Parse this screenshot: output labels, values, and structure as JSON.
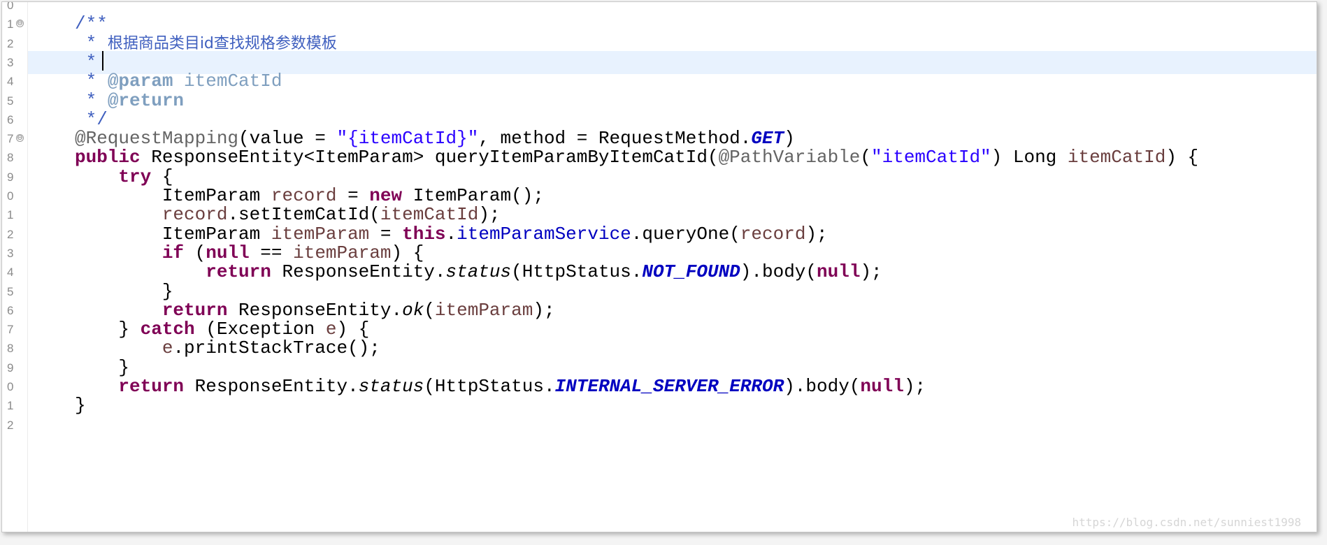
{
  "editor": {
    "line_numbers": [
      "0",
      "1",
      "2",
      "3",
      "4",
      "5",
      "6",
      "7",
      "8",
      "9",
      "0",
      "1",
      "2",
      "3",
      "4",
      "5",
      "6",
      "7",
      "8",
      "9",
      "0",
      "1",
      "2"
    ],
    "fold_markers": [
      "⊖",
      "⊖"
    ],
    "lines": [
      {
        "tokens": []
      },
      {
        "tokens": [
          {
            "c": "jd",
            "t": "/**"
          }
        ]
      },
      {
        "tokens": [
          {
            "c": "jd",
            "t": " * "
          },
          {
            "c": "jd cjk",
            "t": "根据商品类目id查找规格参数模板"
          }
        ]
      },
      {
        "tokens": [
          {
            "c": "jd",
            "t": " *"
          }
        ],
        "current": true
      },
      {
        "tokens": [
          {
            "c": "jd",
            "t": " * "
          },
          {
            "c": "jtag",
            "t": "@param"
          },
          {
            "c": "jtag-plain",
            "t": " itemCatId"
          }
        ]
      },
      {
        "tokens": [
          {
            "c": "jd",
            "t": " * "
          },
          {
            "c": "jtag",
            "t": "@return"
          }
        ]
      },
      {
        "tokens": [
          {
            "c": "jd",
            "t": " */"
          }
        ]
      },
      {
        "tokens": [
          {
            "c": "ann",
            "t": "@RequestMapping"
          },
          {
            "c": "",
            "t": "(value = "
          },
          {
            "c": "str",
            "t": "\"{itemCatId}\""
          },
          {
            "c": "",
            "t": ", method = RequestMethod."
          },
          {
            "c": "sfld",
            "t": "GET"
          },
          {
            "c": "",
            "t": ")"
          }
        ]
      },
      {
        "tokens": [
          {
            "c": "kw",
            "t": "public"
          },
          {
            "c": "",
            "t": " ResponseEntity<ItemParam> queryItemParamByItemCatId("
          },
          {
            "c": "ann",
            "t": "@PathVariable"
          },
          {
            "c": "",
            "t": "("
          },
          {
            "c": "str",
            "t": "\"itemCatId\""
          },
          {
            "c": "",
            "t": ") Long "
          },
          {
            "c": "var",
            "t": "itemCatId"
          },
          {
            "c": "",
            "t": ") {"
          }
        ]
      },
      {
        "tokens": [
          {
            "c": "",
            "t": "    "
          },
          {
            "c": "kw",
            "t": "try"
          },
          {
            "c": "",
            "t": " {"
          }
        ]
      },
      {
        "tokens": [
          {
            "c": "",
            "t": "        ItemParam "
          },
          {
            "c": "var",
            "t": "record"
          },
          {
            "c": "",
            "t": " = "
          },
          {
            "c": "kw",
            "t": "new"
          },
          {
            "c": "",
            "t": " ItemParam();"
          }
        ]
      },
      {
        "tokens": [
          {
            "c": "",
            "t": "        "
          },
          {
            "c": "var",
            "t": "record"
          },
          {
            "c": "",
            "t": ".setItemCatId("
          },
          {
            "c": "var",
            "t": "itemCatId"
          },
          {
            "c": "",
            "t": ");"
          }
        ]
      },
      {
        "tokens": [
          {
            "c": "",
            "t": "        ItemParam "
          },
          {
            "c": "var",
            "t": "itemParam"
          },
          {
            "c": "",
            "t": " = "
          },
          {
            "c": "kw",
            "t": "this"
          },
          {
            "c": "",
            "t": "."
          },
          {
            "c": "fld",
            "t": "itemParamService"
          },
          {
            "c": "",
            "t": ".queryOne("
          },
          {
            "c": "var",
            "t": "record"
          },
          {
            "c": "",
            "t": ");"
          }
        ]
      },
      {
        "tokens": [
          {
            "c": "",
            "t": "        "
          },
          {
            "c": "kw",
            "t": "if"
          },
          {
            "c": "",
            "t": " ("
          },
          {
            "c": "kw",
            "t": "null"
          },
          {
            "c": "",
            "t": " == "
          },
          {
            "c": "var",
            "t": "itemParam"
          },
          {
            "c": "",
            "t": ") {"
          }
        ]
      },
      {
        "tokens": [
          {
            "c": "",
            "t": "            "
          },
          {
            "c": "kw",
            "t": "return"
          },
          {
            "c": "",
            "t": " ResponseEntity."
          },
          {
            "c": "sm",
            "t": "status"
          },
          {
            "c": "",
            "t": "(HttpStatus."
          },
          {
            "c": "sfld",
            "t": "NOT_FOUND"
          },
          {
            "c": "",
            "t": ").body("
          },
          {
            "c": "kw",
            "t": "null"
          },
          {
            "c": "",
            "t": ");"
          }
        ]
      },
      {
        "tokens": [
          {
            "c": "",
            "t": "        }"
          }
        ]
      },
      {
        "tokens": [
          {
            "c": "",
            "t": "        "
          },
          {
            "c": "kw",
            "t": "return"
          },
          {
            "c": "",
            "t": " ResponseEntity."
          },
          {
            "c": "sm",
            "t": "ok"
          },
          {
            "c": "",
            "t": "("
          },
          {
            "c": "var",
            "t": "itemParam"
          },
          {
            "c": "",
            "t": ");"
          }
        ]
      },
      {
        "tokens": [
          {
            "c": "",
            "t": "    } "
          },
          {
            "c": "kw",
            "t": "catch"
          },
          {
            "c": "",
            "t": " (Exception "
          },
          {
            "c": "var",
            "t": "e"
          },
          {
            "c": "",
            "t": ") {"
          }
        ]
      },
      {
        "tokens": [
          {
            "c": "",
            "t": "        "
          },
          {
            "c": "var",
            "t": "e"
          },
          {
            "c": "",
            "t": ".printStackTrace();"
          }
        ]
      },
      {
        "tokens": [
          {
            "c": "",
            "t": "    }"
          }
        ]
      },
      {
        "tokens": [
          {
            "c": "",
            "t": "    "
          },
          {
            "c": "kw",
            "t": "return"
          },
          {
            "c": "",
            "t": " ResponseEntity."
          },
          {
            "c": "sm",
            "t": "status"
          },
          {
            "c": "",
            "t": "(HttpStatus."
          },
          {
            "c": "sfld",
            "t": "INTERNAL_SERVER_ERROR"
          },
          {
            "c": "",
            "t": ").body("
          },
          {
            "c": "kw",
            "t": "null"
          },
          {
            "c": "",
            "t": ");"
          }
        ]
      },
      {
        "tokens": [
          {
            "c": "",
            "t": "}"
          }
        ]
      },
      {
        "tokens": []
      }
    ]
  },
  "watermark": "https://blog.csdn.net/sunniest1998",
  "colors": {
    "keyword": "#7f0055",
    "string": "#2a00ff",
    "javadoc": "#3f5fbf",
    "javadoc_tag": "#7f9fbf",
    "annotation": "#646464",
    "field": "#0000c0",
    "local_variable": "#6a3e3e",
    "current_line": "#e8f2fe"
  }
}
